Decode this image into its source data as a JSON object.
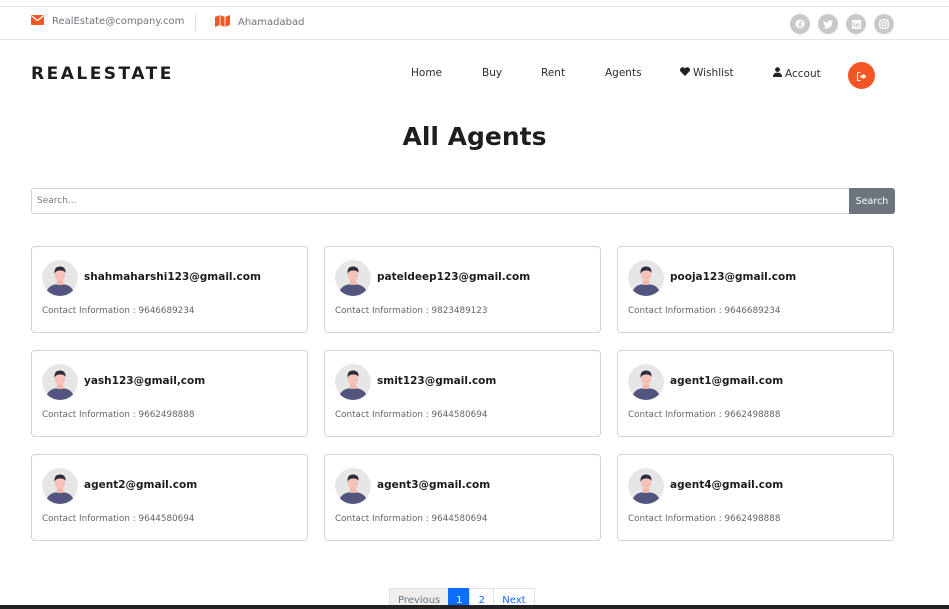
{
  "topbar": {
    "email": "RealEstate@company.com",
    "location": "Ahamadabad",
    "social_icons": [
      "facebook-icon",
      "twitter-icon",
      "linkedin-icon",
      "instagram-icon"
    ]
  },
  "nav": {
    "logo": "REALESTATE",
    "links": [
      "Home",
      "Buy",
      "Rent",
      "Agents"
    ],
    "wishlist": "Wishlist",
    "account": "Accout"
  },
  "page": {
    "title": "All Agents"
  },
  "search": {
    "placeholder": "Search...",
    "button": "Search"
  },
  "agents": [
    {
      "email": "shahmaharshi123@gmail.com",
      "contact": "Contact Information : 9646689234"
    },
    {
      "email": "pateldeep123@gmail.com",
      "contact": "Contact Information : 9823489123"
    },
    {
      "email": "pooja123@gmail.com",
      "contact": "Contact Information : 9646689234"
    },
    {
      "email": "yash123@gmail,com",
      "contact": "Contact Information : 9662498888"
    },
    {
      "email": "smit123@gmail.com",
      "contact": "Contact Information : 9644580694"
    },
    {
      "email": "agent1@gmail.com",
      "contact": "Contact Information : 9662498888"
    },
    {
      "email": "agent2@gmail.com",
      "contact": "Contact Information : 9644580694"
    },
    {
      "email": "agent3@gmail.com",
      "contact": "Contact Information : 9644580694"
    },
    {
      "email": "agent4@gmail.com",
      "contact": "Contact Information : 9662498888"
    }
  ],
  "pagination": {
    "previous": "Previous",
    "pages": [
      "1",
      "2"
    ],
    "current": "1",
    "next": "Next"
  },
  "colors": {
    "accent": "#f35525",
    "primary": "#0d6efd",
    "search_button": "#6c757d"
  }
}
